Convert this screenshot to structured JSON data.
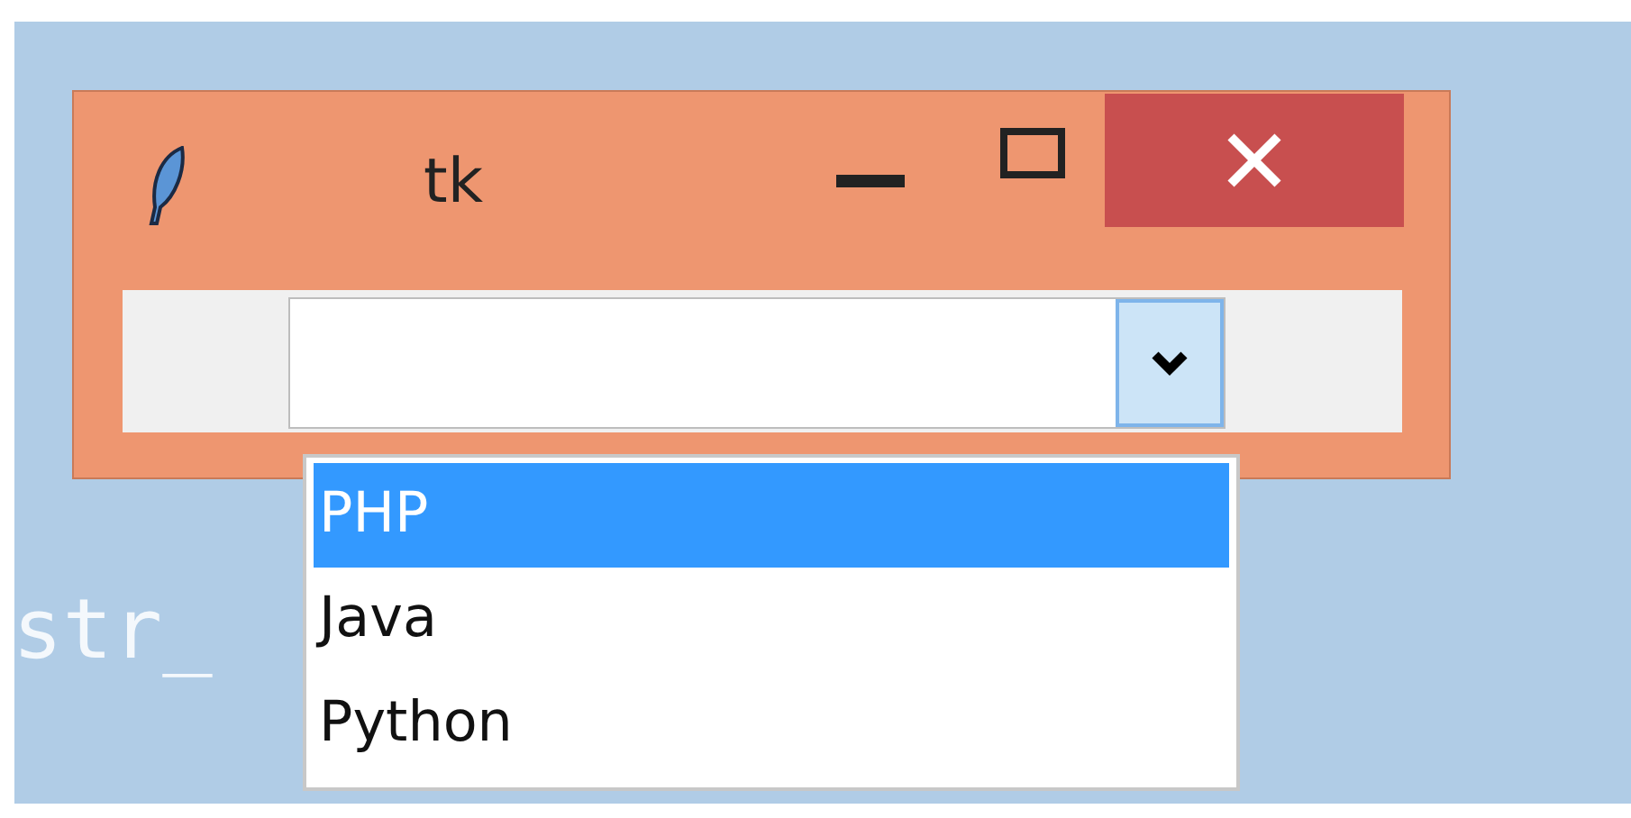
{
  "window": {
    "title": "tk"
  },
  "combobox": {
    "expanded": true,
    "options": [
      {
        "label": "PHP",
        "selected": true
      },
      {
        "label": "Java",
        "selected": false
      },
      {
        "label": "Python",
        "selected": false
      }
    ]
  },
  "background_code": "str_"
}
